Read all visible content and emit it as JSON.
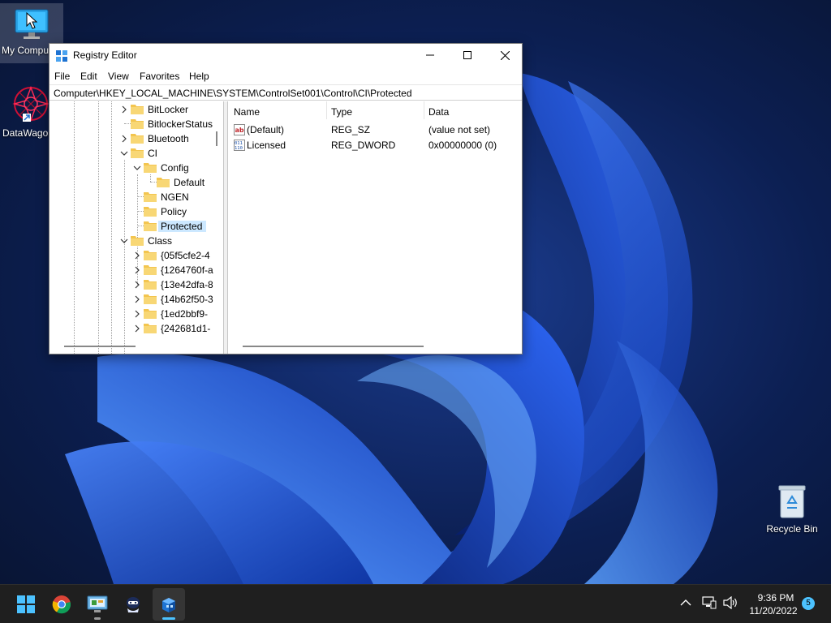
{
  "desktop": {
    "icons": [
      {
        "label": "My Computer"
      },
      {
        "label": "DataWagon"
      },
      {
        "label": "Recycle Bin"
      }
    ]
  },
  "window": {
    "title": "Registry Editor",
    "menu": [
      "File",
      "Edit",
      "View",
      "Favorites",
      "Help"
    ],
    "address": "Computer\\HKEY_LOCAL_MACHINE\\SYSTEM\\ControlSet001\\Control\\CI\\Protected",
    "tree": [
      {
        "label": "BitLocker",
        "expanded": false
      },
      {
        "label": "BitlockerStatus",
        "expanded": null
      },
      {
        "label": "Bluetooth",
        "expanded": false
      },
      {
        "label": "CI",
        "expanded": true
      },
      {
        "label": "Config",
        "expanded": true
      },
      {
        "label": "Default",
        "expanded": null
      },
      {
        "label": "NGEN",
        "expanded": null
      },
      {
        "label": "Policy",
        "expanded": null
      },
      {
        "label": "Protected",
        "expanded": null,
        "selected": true
      },
      {
        "label": "Class",
        "expanded": true
      },
      {
        "label": "{05f5cfe2-4",
        "expanded": false
      },
      {
        "label": "{1264760f-a",
        "expanded": false
      },
      {
        "label": "{13e42dfa-8",
        "expanded": false
      },
      {
        "label": "{14b62f50-3",
        "expanded": false
      },
      {
        "label": "{1ed2bbf9-",
        "expanded": false
      },
      {
        "label": "{242681d1-",
        "expanded": false
      }
    ],
    "columns": {
      "name": "Name",
      "type": "Type",
      "data": "Data"
    },
    "values": [
      {
        "name": "(Default)",
        "type": "REG_SZ",
        "data": "(value not set)",
        "icon": "string-value-icon"
      },
      {
        "name": "Licensed",
        "type": "REG_DWORD",
        "data": "0x00000000 (0)",
        "icon": "binary-value-icon"
      }
    ]
  },
  "taskbar": {
    "apps": [
      "start-icon",
      "chrome-icon",
      "control-panel-icon",
      "agent-app-icon",
      "registry-editor-icon"
    ],
    "clock_time": "9:36 PM",
    "clock_date": "11/20/2022",
    "notification_count": "5"
  },
  "colors": {
    "accent": "#4cc2ff",
    "selection": "#cce8ff",
    "folder": "#f3c54f"
  }
}
